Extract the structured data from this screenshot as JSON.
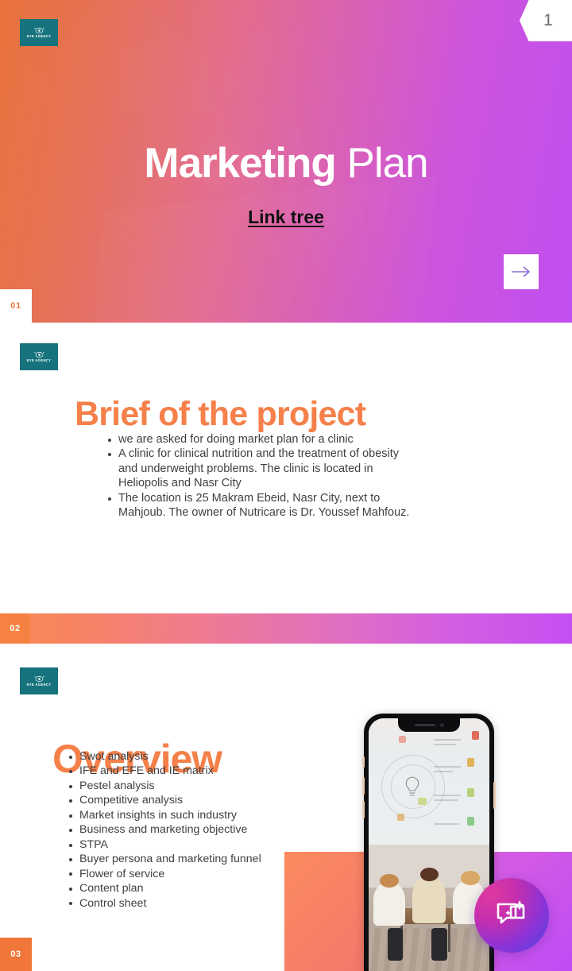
{
  "brand": {
    "logo_name": "EYE AGENCY",
    "logo_color": "#16737d",
    "accent_orange": "#f5804a",
    "accent_purple": "#c04ff0"
  },
  "slide1": {
    "page_indicator": "1",
    "title_bold": "Marketing",
    "title_light": " Plan",
    "link_label": "Link tree",
    "next_arrow_icon": "arrow-right-icon",
    "number": "01"
  },
  "slide2": {
    "heading": "Brief of the project",
    "number": "02",
    "bullets": [
      "we are asked for doing market plan for a clinic",
      "A clinic for clinical nutrition and the treatment of obesity and underweight problems. The clinic is located in Heliopolis and Nasr City",
      "The location is 25 Makram Ebeid, Nasr City, next to Mahjoub. The owner of Nutricare is Dr. Youssef Mahfouz."
    ]
  },
  "slide3": {
    "heading": "Overview",
    "number": "03",
    "bullets": [
      "Swot analysis",
      "IFE and EFE and IE matrix",
      "Pestel analysis",
      "Competitive analysis",
      "Market insights in such industry",
      "Business and marketing objective",
      "STPA",
      "Buyer persona and marketing funnel",
      "Flower of service",
      "Content plan",
      "Control sheet"
    ],
    "phone_mockup_alt": "phone showing a business meeting presentation",
    "assistant_icon": "chat-sparkle-icon"
  }
}
